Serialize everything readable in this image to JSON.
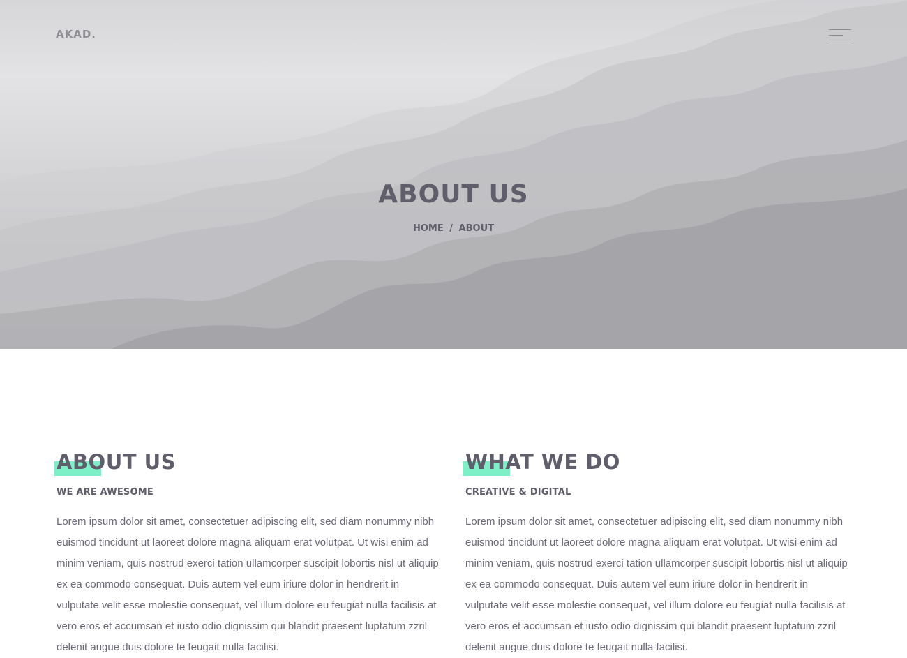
{
  "header": {
    "logo": "AKAD.",
    "menu_icon": "hamburger-menu-icon"
  },
  "hero": {
    "title": "ABOUT US",
    "breadcrumb": {
      "home": "HOME",
      "separator": "/",
      "current": "ABOUT"
    }
  },
  "sections": [
    {
      "title": "ABOUT US",
      "subtitle": "WE ARE AWESOME",
      "body": "Lorem ipsum dolor sit amet, consectetuer adipiscing elit, sed diam nonummy nibh euismod tincidunt ut laoreet dolore magna aliquam erat volutpat. Ut wisi enim ad minim veniam, quis nostrud exerci tation ullamcorper suscipit lobortis nisl ut aliquip ex ea commodo consequat. Duis autem vel eum iriure dolor in hendrerit in vulputate velit esse molestie consequat, vel illum dolore eu feugiat nulla facilisis at vero eros et accumsan et iusto odio dignissim qui blandit praesent luptatum zzril delenit augue duis dolore te feugait nulla facilisi."
    },
    {
      "title": "WHAT WE DO",
      "subtitle": "CREATIVE & DIGITAL",
      "body": "Lorem ipsum dolor sit amet, consectetuer adipiscing elit, sed diam nonummy nibh euismod tincidunt ut laoreet dolore magna aliquam erat volutpat. Ut wisi enim ad minim veniam, quis nostrud exerci tation ullamcorper suscipit lobortis nisl ut aliquip ex ea commodo consequat. Duis autem vel eum iriure dolor in hendrerit in vulputate velit esse molestie consequat, vel illum dolore eu feugiat nulla facilisis at vero eros et accumsan et iusto odio dignissim qui blandit praesent luptatum zzril delenit augue duis dolore te feugait nulla facilisi."
    }
  ],
  "colors": {
    "accent": "#7ef0c7",
    "heading": "#5f5e6a",
    "body_text": "#6a6977"
  }
}
